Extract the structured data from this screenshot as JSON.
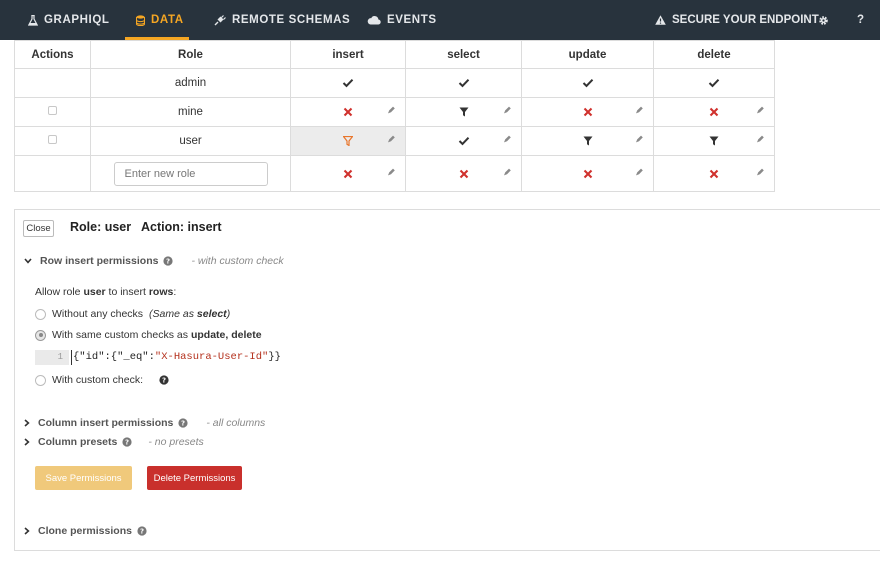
{
  "nav": {
    "items": [
      {
        "label": "GRAPHIQL",
        "icon": "flask-icon"
      },
      {
        "label": "DATA",
        "icon": "database-icon",
        "active": true
      },
      {
        "label": "REMOTE SCHEMAS",
        "icon": "plug-icon"
      },
      {
        "label": "EVENTS",
        "icon": "cloud-icon"
      }
    ],
    "secure_label": "SECURE YOUR ENDPOINT",
    "settings_icon": "gear-icon",
    "help_label": "?"
  },
  "table": {
    "headers": [
      "Actions",
      "Role",
      "insert",
      "select",
      "update",
      "delete"
    ],
    "rows": [
      {
        "role": "admin",
        "insert": "check",
        "select": "check",
        "update": "check",
        "delete": "check",
        "editable": false
      },
      {
        "role": "mine",
        "insert": "cross",
        "select": "filter",
        "update": "cross",
        "delete": "cross",
        "editable": true
      },
      {
        "role": "user",
        "insert": "filter-active",
        "select": "check",
        "update": "filter",
        "delete": "filter",
        "editable": true
      }
    ],
    "new_role_placeholder": "Enter new role",
    "new_row": {
      "insert": "cross",
      "select": "cross",
      "update": "cross",
      "delete": "cross"
    }
  },
  "panel": {
    "close_label": "Close",
    "role_heading": "Role: user",
    "action_heading": "Action: insert",
    "row_section_title": "Row insert permissions",
    "row_section_note": "- with custom check",
    "allow_prefix": "Allow role ",
    "allow_role": "user",
    "allow_middle": " to insert ",
    "allow_target": "rows",
    "allow_suffix": ":",
    "option1_label": "Without any checks",
    "option1_note_prefix": "(Same as ",
    "option1_note_bold": "select",
    "option1_note_suffix": ")",
    "option2_prefix": "With same custom checks as ",
    "option2_bold": "update, delete",
    "code_line_number": "1",
    "code_open": "{\"id\":{\"_eq\":",
    "code_string": "\"X-Hasura-User-Id\"",
    "code_close": "}}",
    "option3_label": "With custom check:",
    "column_section_title": "Column insert permissions",
    "column_section_note": "- all columns",
    "presets_section_title": "Column presets",
    "presets_section_note": "- no presets",
    "save_label": "Save Permissions",
    "delete_label": "Delete Permissions",
    "clone_section_title": "Clone permissions"
  },
  "colors": {
    "nav_bg": "#28333d",
    "accent": "#f5a623",
    "check": "#333333",
    "cross": "#d0312d",
    "filter_active": "#e8762c",
    "save_button": "#f0c97b",
    "delete_button": "#c9302c"
  }
}
